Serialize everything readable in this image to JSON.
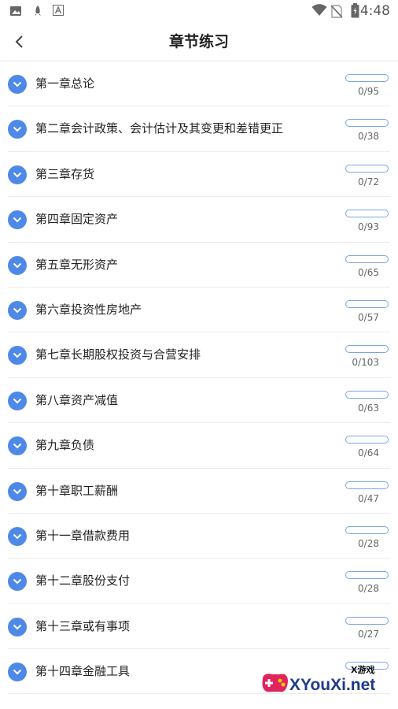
{
  "status_bar": {
    "time": "4:48",
    "left_icons": [
      "image-icon",
      "rocket-icon",
      "font-app-icon"
    ],
    "right_icons": [
      "wifi-icon",
      "no-sim-icon",
      "battery-icon"
    ]
  },
  "header": {
    "title": "章节练习",
    "back_icon": "chevron-left-icon"
  },
  "colors": {
    "accent": "#4e89e8",
    "track_border": "#7aa5ea"
  },
  "chapters": [
    {
      "label": "第一章总论",
      "count": "0/95",
      "progress": 0
    },
    {
      "label": "第二章会计政策、会计估计及其变更和差错更正",
      "count": "0/38",
      "progress": 0
    },
    {
      "label": "第三章存货",
      "count": "0/72",
      "progress": 0
    },
    {
      "label": "第四章固定资产",
      "count": "0/93",
      "progress": 0
    },
    {
      "label": "第五章无形资产",
      "count": "0/65",
      "progress": 0
    },
    {
      "label": "第六章投资性房地产",
      "count": "0/57",
      "progress": 0
    },
    {
      "label": "第七章长期股权投资与合营安排",
      "count": "0/103",
      "progress": 0
    },
    {
      "label": "第八章资产减值",
      "count": "0/63",
      "progress": 0
    },
    {
      "label": "第九章负债",
      "count": "0/64",
      "progress": 0
    },
    {
      "label": "第十章职工薪酬",
      "count": "0/47",
      "progress": 0
    },
    {
      "label": "第十一章借款费用",
      "count": "0/28",
      "progress": 0
    },
    {
      "label": "第十二章股份支付",
      "count": "0/28",
      "progress": 0
    },
    {
      "label": "第十三章或有事项",
      "count": "0/27",
      "progress": 0
    },
    {
      "label": "第十四章金融工具",
      "count": "",
      "progress": 0
    }
  ],
  "watermark": {
    "small_text": "X游戏",
    "big_text": "XYouXi.net"
  }
}
